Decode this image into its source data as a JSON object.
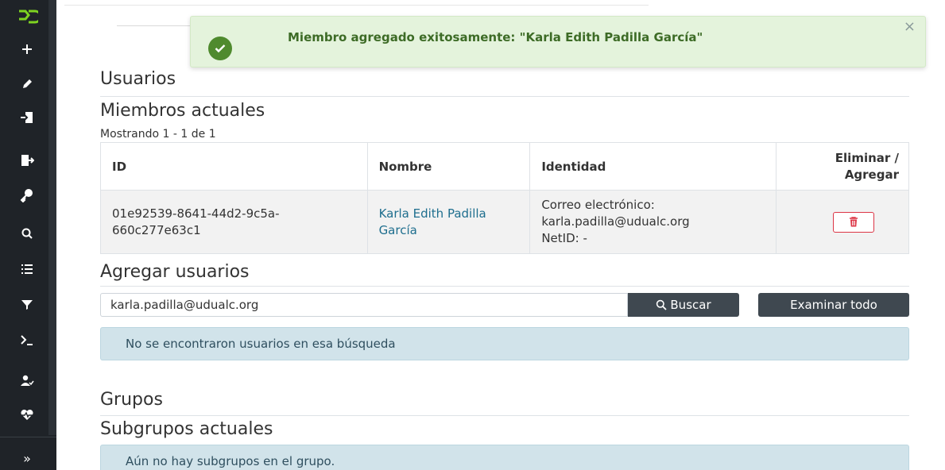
{
  "sidebar": {
    "logo": "app-logo-icon",
    "items": [
      {
        "name": "plus-icon",
        "glyph": "+"
      },
      {
        "name": "pencil-icon",
        "glyph": "✎"
      },
      {
        "name": "import-icon",
        "glyph": "⇥"
      },
      {
        "name": "export-icon",
        "glyph": "⇨"
      },
      {
        "name": "key-icon",
        "glyph": "⚷"
      },
      {
        "name": "search-icon",
        "glyph": "⚲"
      },
      {
        "name": "list-icon",
        "glyph": "☰"
      },
      {
        "name": "filter-icon",
        "glyph": "▼"
      },
      {
        "name": "terminal-icon",
        "glyph": ">_"
      },
      {
        "name": "user-check-icon",
        "glyph": "👤"
      },
      {
        "name": "heartbeat-icon",
        "glyph": "♥"
      }
    ],
    "expand_label": "»"
  },
  "toast": {
    "message": "Miembro agregado exitosamente: \"Karla Edith Padilla García\"",
    "close_label": "×",
    "color": "#e4f3dc"
  },
  "users": {
    "title": "Usuarios",
    "members_title": "Miembros actuales",
    "showing": "Mostrando 1 - 1 de 1",
    "table": {
      "headers": {
        "id": "ID",
        "name": "Nombre",
        "identity": "Identidad",
        "action": "Eliminar / Agregar"
      },
      "rows": [
        {
          "id": "01e92539-8641-44d2-9c5a-660c277e63c1",
          "name": "Karla Edith Padilla García",
          "identity_email": "Correo electrónico: karla.padilla@udualc.org",
          "identity_netid": "NetID: -"
        }
      ]
    },
    "add_title": "Agregar usuarios",
    "search_value": "karla.padilla@udualc.org",
    "search_button": "Buscar",
    "browse_button": "Examinar todo",
    "no_results": "No se encontraron usuarios en esa búsqueda"
  },
  "groups": {
    "title": "Grupos",
    "subgroups_title": "Subgrupos actuales",
    "no_subgroups": "Aún no hay subgrupos en el grupo."
  }
}
